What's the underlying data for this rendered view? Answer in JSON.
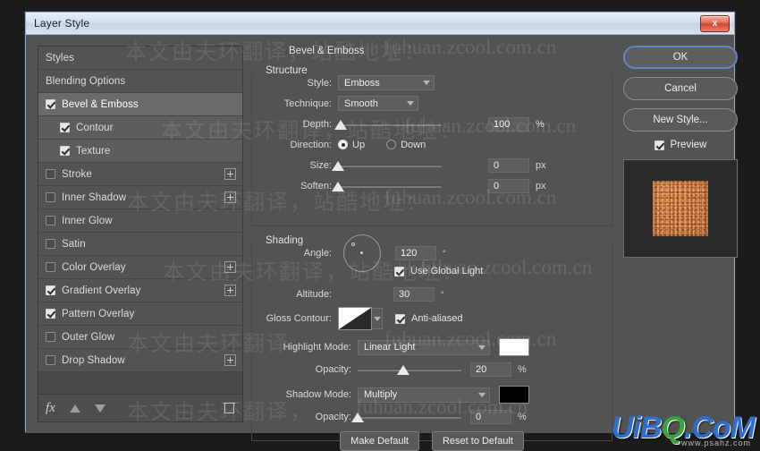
{
  "window": {
    "title": "Layer Style",
    "close_label": "x"
  },
  "styles_panel": {
    "items": [
      {
        "label": "Styles",
        "checkbox": "none",
        "sub": false,
        "selected": false,
        "plus": false
      },
      {
        "label": "Blending Options",
        "checkbox": "none",
        "sub": false,
        "selected": false,
        "plus": false
      },
      {
        "label": "Bevel & Emboss",
        "checkbox": "checked",
        "sub": false,
        "selected": true,
        "plus": false
      },
      {
        "label": "Contour",
        "checkbox": "checked",
        "sub": true,
        "selected": false,
        "plus": false
      },
      {
        "label": "Texture",
        "checkbox": "checked",
        "sub": true,
        "selected": false,
        "plus": false
      },
      {
        "label": "Stroke",
        "checkbox": "unchecked",
        "sub": false,
        "selected": false,
        "plus": true
      },
      {
        "label": "Inner Shadow",
        "checkbox": "unchecked",
        "sub": false,
        "selected": false,
        "plus": true
      },
      {
        "label": "Inner Glow",
        "checkbox": "unchecked",
        "sub": false,
        "selected": false,
        "plus": false
      },
      {
        "label": "Satin",
        "checkbox": "unchecked",
        "sub": false,
        "selected": false,
        "plus": false
      },
      {
        "label": "Color Overlay",
        "checkbox": "unchecked",
        "sub": false,
        "selected": false,
        "plus": true
      },
      {
        "label": "Gradient Overlay",
        "checkbox": "checked",
        "sub": false,
        "selected": false,
        "plus": true
      },
      {
        "label": "Pattern Overlay",
        "checkbox": "checked",
        "sub": false,
        "selected": false,
        "plus": false
      },
      {
        "label": "Outer Glow",
        "checkbox": "unchecked",
        "sub": false,
        "selected": false,
        "plus": false
      },
      {
        "label": "Drop Shadow",
        "checkbox": "unchecked",
        "sub": false,
        "selected": false,
        "plus": true
      }
    ],
    "footer": {
      "fx_label": "fx",
      "move_up_icon": "arrow-up-icon",
      "move_down_icon": "arrow-down-icon",
      "delete_icon": "trash-icon"
    }
  },
  "main": {
    "panel_title": "Bevel & Emboss",
    "structure": {
      "legend": "Structure",
      "style_label": "Style:",
      "style_value": "Emboss",
      "technique_label": "Technique:",
      "technique_value": "Smooth",
      "depth_label": "Depth:",
      "depth_value": "100",
      "depth_unit": "%",
      "depth_percent": 100,
      "direction_label": "Direction:",
      "direction_up": "Up",
      "direction_down": "Down",
      "direction_selected": "Up",
      "size_label": "Size:",
      "size_value": "0",
      "size_unit": "px",
      "size_percent": 0,
      "soften_label": "Soften:",
      "soften_value": "0",
      "soften_unit": "px",
      "soften_percent": 0
    },
    "shading": {
      "legend": "Shading",
      "angle_label": "Angle:",
      "angle_value": "120",
      "angle_unit": "°",
      "global_light_label": "Use Global Light",
      "global_light_checked": true,
      "altitude_label": "Altitude:",
      "altitude_value": "30",
      "altitude_unit": "°",
      "gloss_contour_label": "Gloss Contour:",
      "anti_aliased_label": "Anti-aliased",
      "anti_aliased_checked": true,
      "highlight_mode_label": "Highlight Mode:",
      "highlight_mode_value": "Linear Light",
      "highlight_color": "#ffffff",
      "highlight_opacity_label": "Opacity:",
      "highlight_opacity_value": "20",
      "highlight_opacity_unit": "%",
      "highlight_opacity_percent": 45,
      "shadow_mode_label": "Shadow Mode:",
      "shadow_mode_value": "Multiply",
      "shadow_color": "#000000",
      "shadow_opacity_label": "Opacity:",
      "shadow_opacity_value": "0",
      "shadow_opacity_unit": "%",
      "shadow_opacity_percent": 0
    }
  },
  "actions": {
    "ok": "OK",
    "cancel": "Cancel",
    "new_style": "New Style...",
    "preview": "Preview",
    "preview_checked": true,
    "make_default": "Make Default",
    "reset_to_default": "Reset to Default"
  },
  "watermarks": {
    "cn1": "本文由夫环翻译，站酷地址：",
    "cn2": "本文由夫环翻译，站酷地址：",
    "cn3": "本文由夫环翻译，",
    "cn4": "本文由夫环翻译，",
    "cn5": "本文由夫环翻译，站酷地址：",
    "en1": "fuhuan.zcool.com.cn",
    "en2": "fuhuan.zcool.com.cn",
    "en3": "fuhuan.zcool.com.cn",
    "en4": "fuhuan.zcool.com.cn",
    "en5": "fuhuan.zcool.com.cn"
  },
  "logo": {
    "part1": "UiB",
    "part2": "Q",
    "part3": ".CoM",
    "sub": "www.psahz.com"
  },
  "colors": {
    "dialog_bg": "#535353",
    "list_row": "#535353",
    "list_row_selected": "#6a6a6a",
    "title_bar": "#d3dfee",
    "accent_focus": "#5f86c4",
    "close_button": "#cf4a30",
    "preview_swatch": "#c96f33"
  }
}
